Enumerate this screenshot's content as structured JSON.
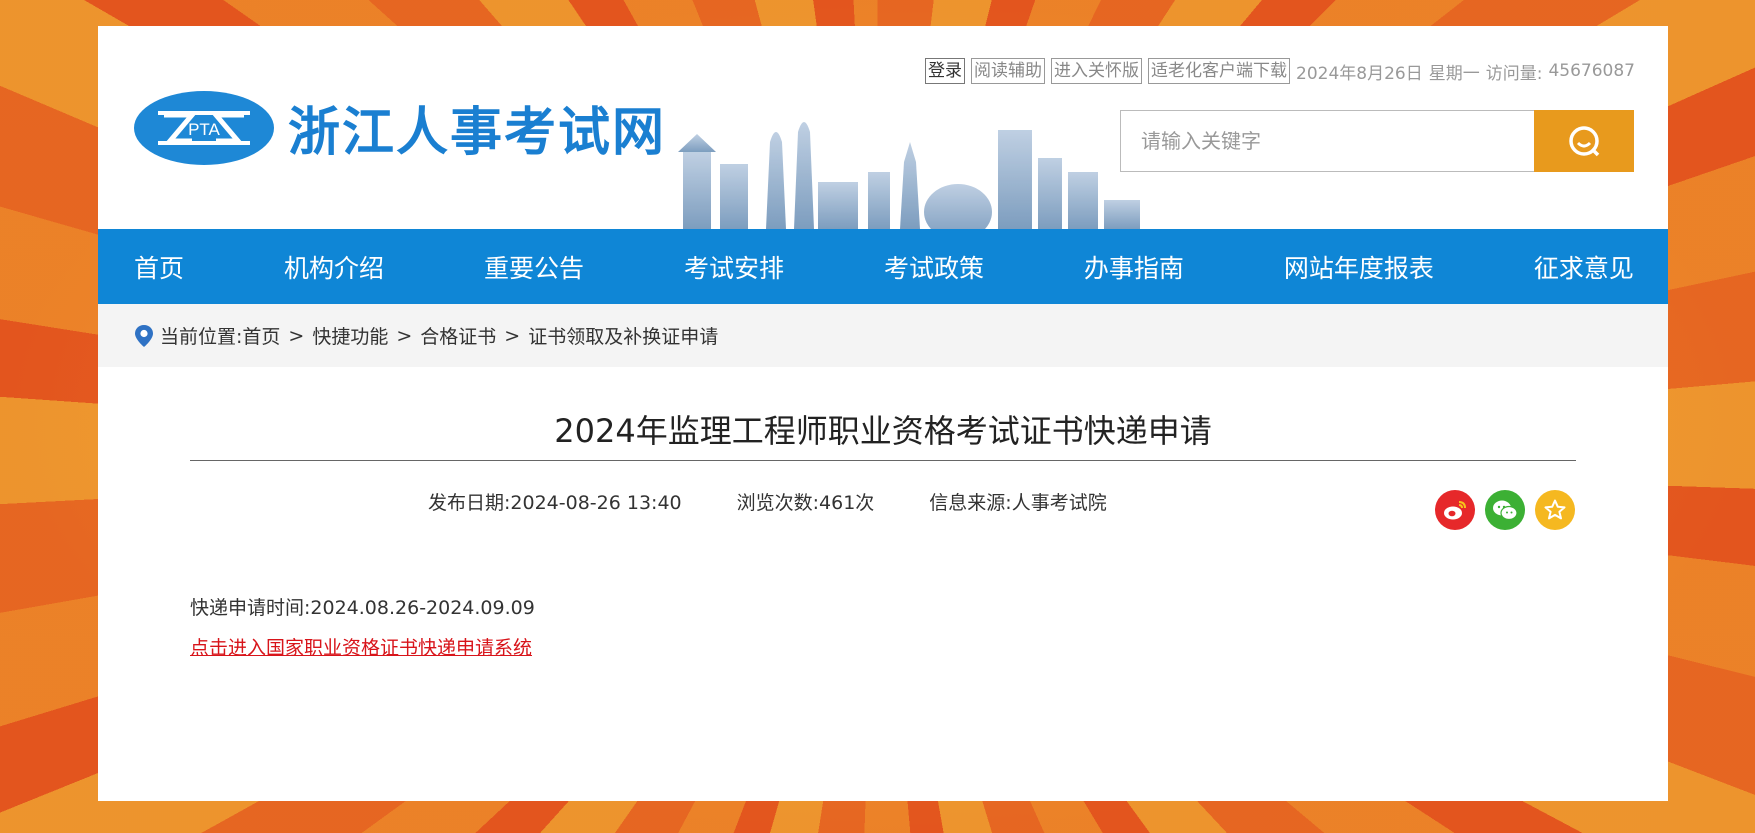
{
  "site": {
    "name": "浙江人事考试网",
    "logo_text": "PTA"
  },
  "toplinks": {
    "login": "登录",
    "reading_aid": "阅读辅助",
    "care_mode": "进入关怀版",
    "elderly_client": "适老化客户端下载",
    "date": "2024年8月26日",
    "weekday": "星期一",
    "visits_label": "访问量:",
    "visits_value": "45676087"
  },
  "search": {
    "placeholder": "请输入关键字"
  },
  "nav": {
    "items": [
      {
        "label": "首页"
      },
      {
        "label": "机构介绍"
      },
      {
        "label": "重要公告"
      },
      {
        "label": "考试安排"
      },
      {
        "label": "考试政策"
      },
      {
        "label": "办事指南"
      },
      {
        "label": "网站年度报表"
      },
      {
        "label": "征求意见"
      }
    ]
  },
  "breadcrumb": {
    "prefix": "当前位置:",
    "items": [
      "首页",
      "快捷功能",
      "合格证书",
      "证书领取及补换证申请"
    ],
    "separator": ">"
  },
  "article": {
    "title": "2024年监理工程师职业资格考试证书快递申请",
    "publish_date": "发布日期:2024-08-26 13:40",
    "views": "浏览次数:461次",
    "source": "信息来源:人事考试院",
    "body_line1": "快递申请时间:2024.08.26-2024.09.09",
    "link_text": "点击进入国家职业资格证书快递申请系统"
  },
  "share": {
    "icons": [
      "weibo-icon",
      "wechat-icon",
      "favorite-icon"
    ]
  },
  "colors": {
    "nav_bg": "#0f86d6",
    "search_btn": "#e89a1d",
    "link": "#d8141a",
    "brand_blue": "#1a7fd1"
  }
}
